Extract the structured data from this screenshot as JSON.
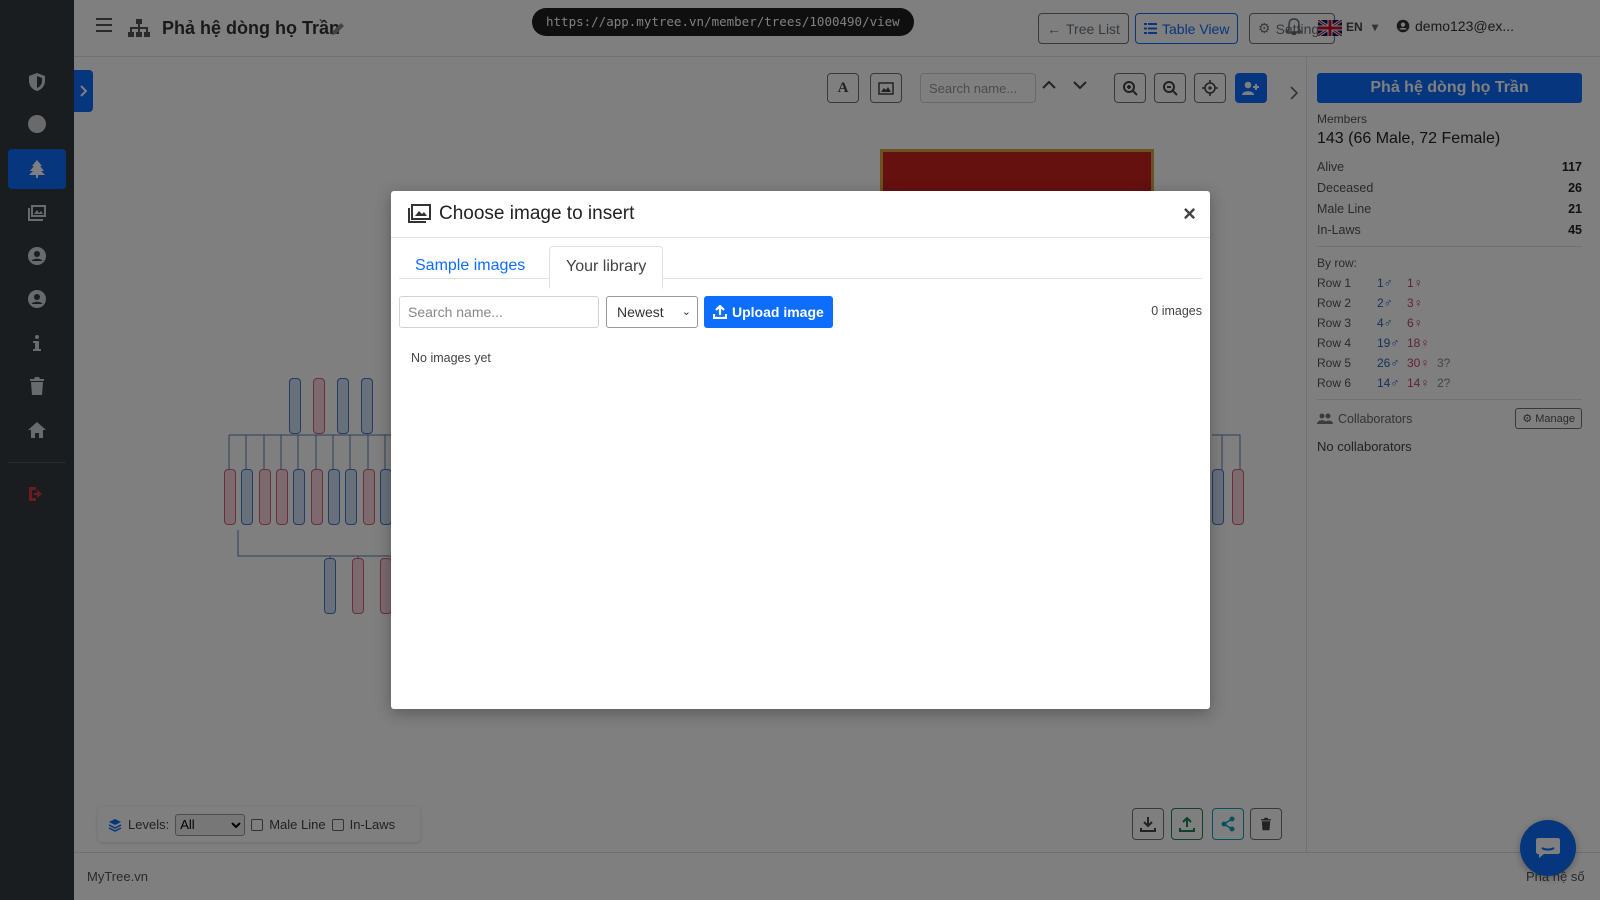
{
  "url": "https://app.mytree.vn/member/trees/1000490/view",
  "header": {
    "title": "Phả hệ dòng họ Trần",
    "buttons": {
      "tree_list": "Tree List",
      "table_view": "Table View",
      "settings": "Settings"
    },
    "language": "EN",
    "user": "demo123@ex..."
  },
  "sidebar": {
    "items": [
      "shield-icon",
      "circle-icon",
      "tree-icon",
      "gallery-icon",
      "user-circle-icon",
      "user-circle-icon",
      "info-icon",
      "trash-icon",
      "home-icon",
      "logout-icon"
    ],
    "active_index": 2
  },
  "canvas": {
    "search_placeholder": "Search name..."
  },
  "bottom_bar": {
    "levels_label": "Levels:",
    "levels_value": "All",
    "male_line": "Male Line",
    "in_laws": "In-Laws"
  },
  "footer": {
    "brand": "MyTree.vn",
    "right": "Phả hệ số"
  },
  "right_panel": {
    "title": "Phả hệ dòng họ Trần",
    "members_label": "Members",
    "members_value": "143 (66 Male, 72 Female)",
    "stats": [
      {
        "label": "Alive",
        "value": "117"
      },
      {
        "label": "Deceased",
        "value": "26"
      },
      {
        "label": "Male Line",
        "value": "21"
      },
      {
        "label": "In-Laws",
        "value": "45"
      }
    ],
    "by_row_label": "By row:",
    "rows": [
      {
        "label": "Row 1",
        "male": "1♂",
        "female": "1♀",
        "unknown": ""
      },
      {
        "label": "Row 2",
        "male": "2♂",
        "female": "3♀",
        "unknown": ""
      },
      {
        "label": "Row 3",
        "male": "4♂",
        "female": "6♀",
        "unknown": ""
      },
      {
        "label": "Row 4",
        "male": "19♂",
        "female": "18♀",
        "unknown": ""
      },
      {
        "label": "Row 5",
        "male": "26♂",
        "female": "30♀",
        "unknown": "3?"
      },
      {
        "label": "Row 6",
        "male": "14♂",
        "female": "14♀",
        "unknown": "2?"
      }
    ],
    "collaborators_label": "Collaborators",
    "manage_label": "Manage",
    "no_collaborators": "No collaborators"
  },
  "modal": {
    "title": "Choose image to insert",
    "close": "×",
    "tabs": [
      "Sample images",
      "Your library"
    ],
    "active_tab": "Your library",
    "search_placeholder": "Search name...",
    "sort_value": "Newest",
    "upload_label": "Upload image",
    "image_count": "0 images",
    "empty_text": "No images yet"
  },
  "colors": {
    "primary": "#0d6efd",
    "sidebar": "#343a40",
    "male": "#4a79c5",
    "female": "#d0637d"
  }
}
